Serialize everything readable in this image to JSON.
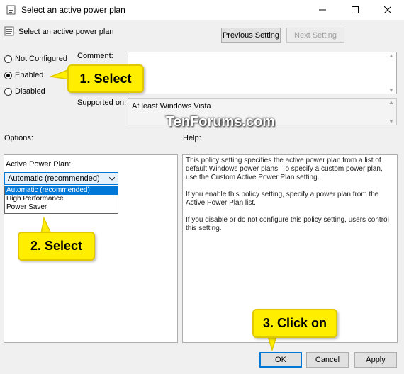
{
  "window": {
    "title": "Select an active power plan",
    "header_title": "Select an active power plan"
  },
  "nav": {
    "previous_label": "Previous Setting",
    "next_label": "Next Setting"
  },
  "state": {
    "options": [
      {
        "label": "Not Configured",
        "checked": false
      },
      {
        "label": "Enabled",
        "checked": true
      },
      {
        "label": "Disabled",
        "checked": false
      }
    ]
  },
  "comment": {
    "label": "Comment:",
    "value": ""
  },
  "supported": {
    "label": "Supported on:",
    "value": "At least Windows Vista"
  },
  "watermark": "TenForums.com",
  "options_label": "Options:",
  "help_label": "Help:",
  "options_panel": {
    "field_label": "Active Power Plan:",
    "selected": "Automatic (recommended)",
    "items": [
      "Automatic (recommended)",
      "High Performance",
      "Power Saver"
    ]
  },
  "help_text": {
    "p1": "This policy setting specifies the active power plan from a list of default Windows power plans. To specify a custom power plan, use the Custom Active Power Plan setting.",
    "p2": "If you enable this policy setting, specify a power plan from the Active Power Plan list.",
    "p3": "If you disable or do not configure this policy setting, users control this setting."
  },
  "callouts": {
    "c1": "1. Select",
    "c2": "2. Select",
    "c3": "3. Click on"
  },
  "buttons": {
    "ok": "OK",
    "cancel": "Cancel",
    "apply": "Apply"
  },
  "colors": {
    "callout": "#ffee00",
    "selection": "#0078d7",
    "watermark": "#ffffff"
  }
}
